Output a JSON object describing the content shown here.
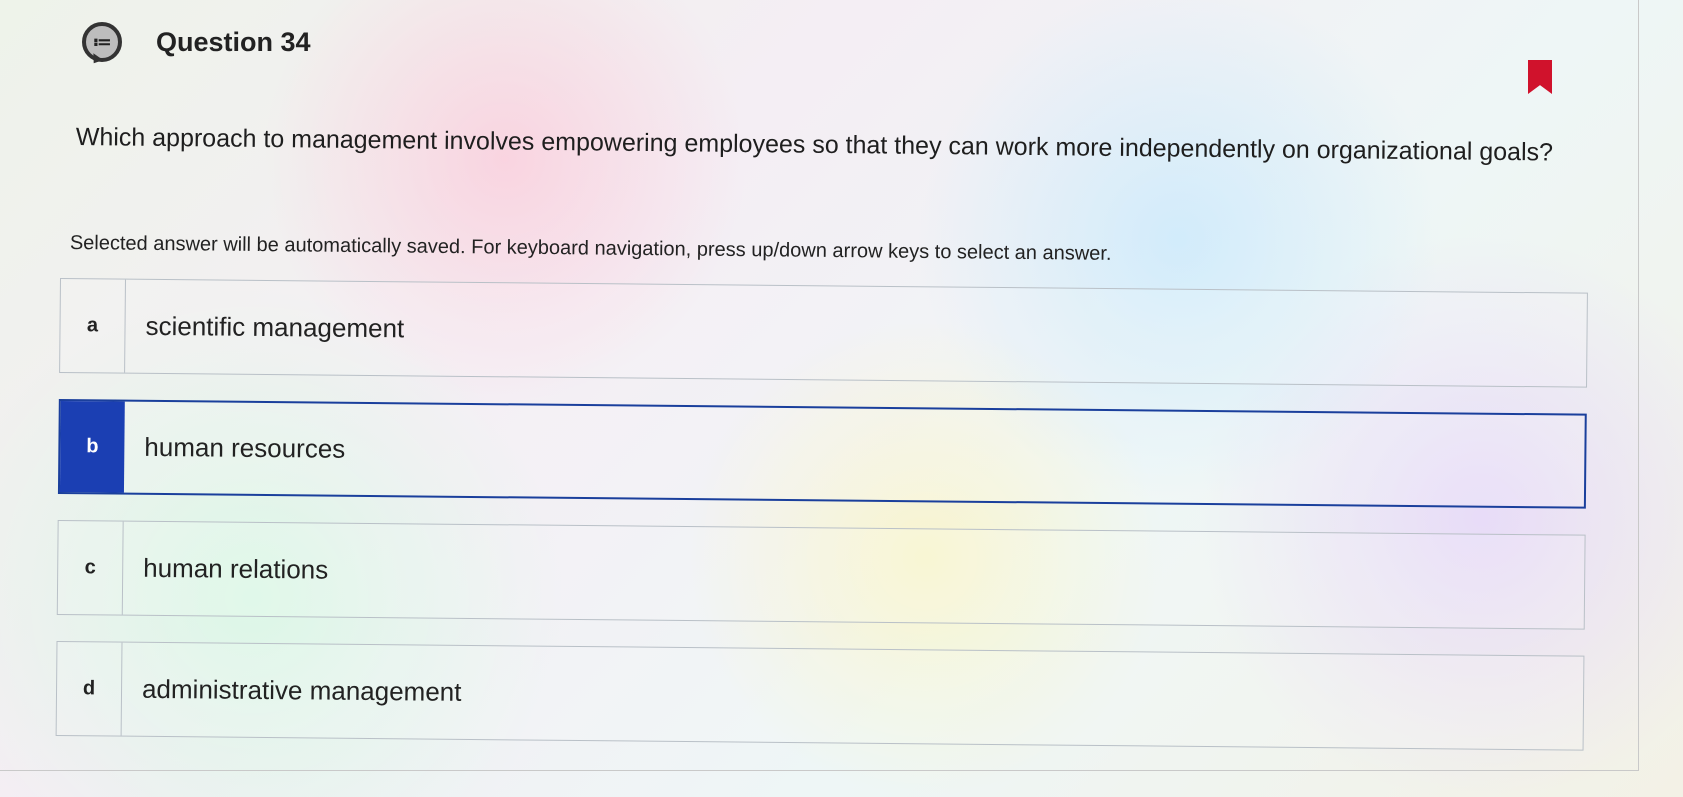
{
  "question": {
    "title": "Question 34",
    "icon": "question-list-icon",
    "text": "Which approach to management involves empowering employees so that they can work more independently on organizational goals?",
    "instructions": "Selected answer will be automatically saved. For keyboard navigation, press up/down arrow keys to select an answer.",
    "bookmark_color": "#d0122c"
  },
  "answers": [
    {
      "letter": "a",
      "text": "scientific management",
      "selected": false
    },
    {
      "letter": "b",
      "text": "human resources",
      "selected": true
    },
    {
      "letter": "c",
      "text": "human relations",
      "selected": false
    },
    {
      "letter": "d",
      "text": "administrative management",
      "selected": false
    }
  ],
  "colors": {
    "selected_accent": "#1b3fb3",
    "option_border": "#b9c0c7"
  }
}
